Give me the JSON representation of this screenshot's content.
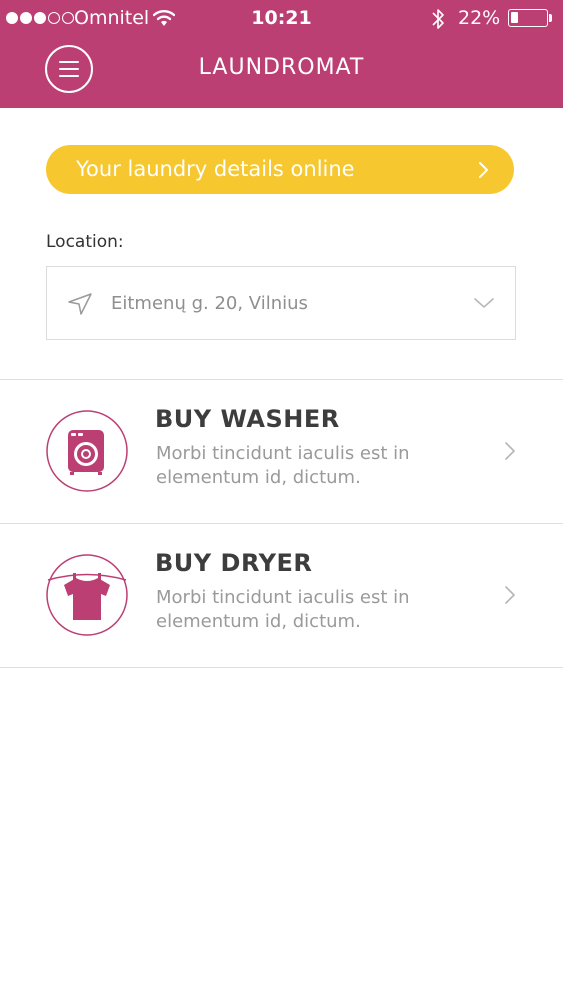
{
  "status_bar": {
    "carrier": "Omnitel",
    "time": "10:21",
    "battery_percent": "22%",
    "battery_level": 0.22,
    "signal_bars_filled": 3,
    "signal_bars_total": 5
  },
  "header": {
    "title": "LAUNDROMAT",
    "menu_icon": "hamburger-menu-icon",
    "background_color": "#bc3f74"
  },
  "cta": {
    "label": "Your laundry details online",
    "icon": "chevron-right-icon",
    "color": "#f6c72f"
  },
  "location": {
    "label": "Location:",
    "value": "Eitmenų g. 20, Vilnius",
    "icon": "location-arrow-icon"
  },
  "options": [
    {
      "title": "BUY WASHER",
      "description": "Morbi tincidunt iaculis est in elementum id, dictum.",
      "icon": "washing-machine-icon"
    },
    {
      "title": "BUY DRYER",
      "description": "Morbi tincidunt iaculis est in elementum id, dictum.",
      "icon": "shirt-on-line-icon"
    }
  ],
  "accent_color": "#bc3f74"
}
